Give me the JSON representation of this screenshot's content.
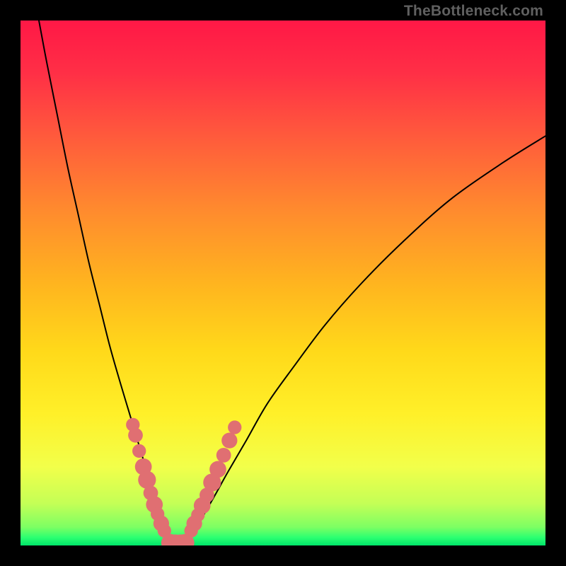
{
  "watermark": "TheBottleneck.com",
  "chart_data": {
    "type": "line",
    "title": "",
    "xlabel": "",
    "ylabel": "",
    "xlim": [
      0,
      100
    ],
    "ylim": [
      0,
      100
    ],
    "curve_left": {
      "name": "left-arm",
      "x": [
        3.5,
        5,
        7,
        9,
        11,
        13,
        15,
        17,
        19,
        20.5,
        22,
        23.5,
        24.7,
        25.8,
        26.7,
        27.4,
        28.0,
        28.5,
        28.9
      ],
      "y": [
        100,
        92,
        82,
        72,
        63,
        54,
        46,
        38,
        31,
        26,
        21,
        16,
        12,
        8.5,
        5.5,
        3.2,
        1.6,
        0.6,
        0.1
      ]
    },
    "curve_right": {
      "name": "right-arm",
      "x": [
        31.3,
        31.8,
        32.6,
        33.6,
        35.0,
        37.0,
        39.5,
        43,
        47,
        52,
        58,
        65,
        73,
        82,
        92,
        100
      ],
      "y": [
        0.1,
        0.6,
        1.8,
        3.5,
        6.0,
        9.5,
        14,
        20,
        27,
        34,
        42,
        50,
        58,
        66,
        73,
        78
      ]
    },
    "curve_bottom": {
      "name": "valley-floor",
      "x": [
        28.9,
        29.4,
        30.0,
        30.7,
        31.3
      ],
      "y": [
        0.1,
        0.0,
        0.0,
        0.0,
        0.1
      ]
    },
    "markers_left": {
      "name": "left-dots",
      "color": "#e06f72",
      "points": [
        {
          "x": 21.4,
          "y": 23.0,
          "r": 1.3
        },
        {
          "x": 21.9,
          "y": 21.0,
          "r": 1.4
        },
        {
          "x": 22.6,
          "y": 18.0,
          "r": 1.3
        },
        {
          "x": 23.4,
          "y": 15.0,
          "r": 1.6
        },
        {
          "x": 24.1,
          "y": 12.5,
          "r": 1.7
        },
        {
          "x": 24.8,
          "y": 10.0,
          "r": 1.4
        },
        {
          "x": 25.5,
          "y": 7.8,
          "r": 1.6
        },
        {
          "x": 26.1,
          "y": 6.0,
          "r": 1.3
        },
        {
          "x": 26.8,
          "y": 4.2,
          "r": 1.5
        },
        {
          "x": 27.4,
          "y": 2.8,
          "r": 1.3
        }
      ]
    },
    "markers_right": {
      "name": "right-dots",
      "color": "#e06f72",
      "points": [
        {
          "x": 32.5,
          "y": 2.8,
          "r": 1.3
        },
        {
          "x": 33.1,
          "y": 4.2,
          "r": 1.5
        },
        {
          "x": 33.8,
          "y": 5.8,
          "r": 1.3
        },
        {
          "x": 34.6,
          "y": 7.6,
          "r": 1.6
        },
        {
          "x": 35.5,
          "y": 9.6,
          "r": 1.4
        },
        {
          "x": 36.5,
          "y": 12.0,
          "r": 1.7
        },
        {
          "x": 37.6,
          "y": 14.5,
          "r": 1.6
        },
        {
          "x": 38.7,
          "y": 17.2,
          "r": 1.4
        },
        {
          "x": 39.8,
          "y": 20.0,
          "r": 1.5
        },
        {
          "x": 40.8,
          "y": 22.5,
          "r": 1.3
        }
      ]
    },
    "valley_blob": {
      "name": "valley-marker",
      "color": "#e06f72",
      "points": [
        {
          "x": 28.5,
          "y": 0.5,
          "r": 1.7
        },
        {
          "x": 29.5,
          "y": 0.3,
          "r": 1.8
        },
        {
          "x": 30.5,
          "y": 0.3,
          "r": 1.8
        },
        {
          "x": 31.4,
          "y": 0.5,
          "r": 1.7
        }
      ]
    },
    "gradient_stops": [
      {
        "offset": 0.0,
        "color": "#ff1846"
      },
      {
        "offset": 0.1,
        "color": "#ff2f46"
      },
      {
        "offset": 0.22,
        "color": "#ff5a3c"
      },
      {
        "offset": 0.36,
        "color": "#ff8a2e"
      },
      {
        "offset": 0.5,
        "color": "#ffb41f"
      },
      {
        "offset": 0.63,
        "color": "#ffd91a"
      },
      {
        "offset": 0.75,
        "color": "#fff029"
      },
      {
        "offset": 0.85,
        "color": "#f2ff4a"
      },
      {
        "offset": 0.92,
        "color": "#c4ff56"
      },
      {
        "offset": 0.965,
        "color": "#7dff63"
      },
      {
        "offset": 0.985,
        "color": "#2bff71"
      },
      {
        "offset": 1.0,
        "color": "#00e46a"
      }
    ]
  }
}
